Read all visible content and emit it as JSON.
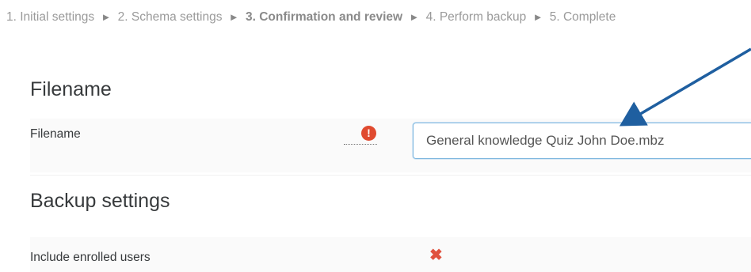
{
  "breadcrumb": {
    "steps": [
      {
        "label": "1. Initial settings"
      },
      {
        "label": "2. Schema settings"
      },
      {
        "label": "3. Confirmation and review"
      },
      {
        "label": "4. Perform backup"
      },
      {
        "label": "5. Complete"
      }
    ],
    "separator": "►"
  },
  "filename_section": {
    "title": "Filename",
    "field_label": "Filename",
    "required_icon": "exclamation-circle",
    "required_glyph": "!",
    "value": "General knowledge Quiz John Doe.mbz"
  },
  "backup_section": {
    "title": "Backup settings",
    "settings": [
      {
        "label": "Include enrolled users",
        "icon": "x-mark",
        "glyph": "✖"
      }
    ]
  },
  "colors": {
    "required_icon": "#e04a2f",
    "cross_icon": "#e0523e",
    "annotation_arrow": "#1f5fa0",
    "input_border": "#7fb7df"
  }
}
